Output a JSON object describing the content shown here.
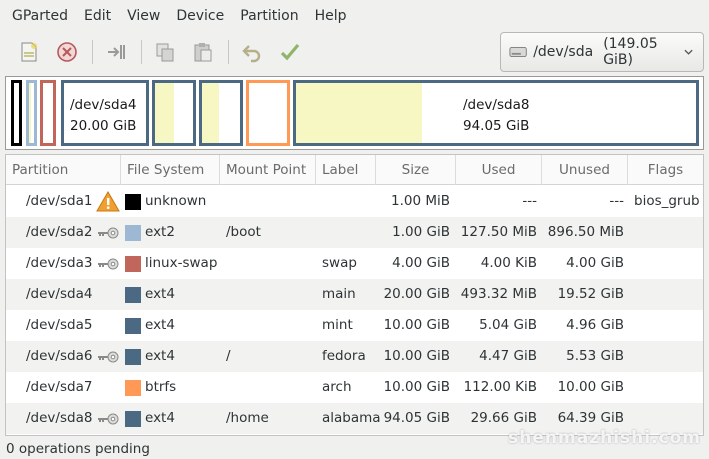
{
  "menu": [
    "GParted",
    "Edit",
    "View",
    "Device",
    "Partition",
    "Help"
  ],
  "toolbar": {
    "icons": [
      "new-partition-icon",
      "delete-partition-icon",
      "resize-move-icon",
      "copy-icon",
      "paste-icon",
      "undo-icon",
      "apply-icon"
    ]
  },
  "device": {
    "name": "/dev/sda",
    "size": "(149.05 GiB)"
  },
  "map": {
    "sda4": {
      "name": "/dev/sda4",
      "size": "20.00 GiB"
    },
    "sda8": {
      "name": "/dev/sda8",
      "size": "94.05 GiB"
    }
  },
  "columns": [
    "Partition",
    "File System",
    "Mount Point",
    "Label",
    "Size",
    "Used",
    "Unused",
    "Flags"
  ],
  "rows": [
    {
      "partition": "/dev/sda1",
      "icon": "warning",
      "fs": "unknown",
      "fs_color": "#000000",
      "mount": "",
      "label": "",
      "size": "1.00 MiB",
      "used": "---",
      "unused": "---",
      "flags": "bios_grub"
    },
    {
      "partition": "/dev/sda2",
      "icon": "key",
      "fs": "ext2",
      "fs_color": "#9db8d2",
      "mount": "/boot",
      "label": "",
      "size": "1.00 GiB",
      "used": "127.50 MiB",
      "unused": "896.50 MiB",
      "flags": ""
    },
    {
      "partition": "/dev/sda3",
      "icon": "key",
      "fs": "linux-swap",
      "fs_color": "#c1665a",
      "mount": "",
      "label": "swap",
      "size": "4.00 GiB",
      "used": "4.00 KiB",
      "unused": "4.00 GiB",
      "flags": ""
    },
    {
      "partition": "/dev/sda4",
      "icon": "",
      "fs": "ext4",
      "fs_color": "#4b6983",
      "mount": "",
      "label": "main",
      "size": "20.00 GiB",
      "used": "493.32 MiB",
      "unused": "19.52 GiB",
      "flags": ""
    },
    {
      "partition": "/dev/sda5",
      "icon": "",
      "fs": "ext4",
      "fs_color": "#4b6983",
      "mount": "",
      "label": "mint",
      "size": "10.00 GiB",
      "used": "5.04 GiB",
      "unused": "4.96 GiB",
      "flags": ""
    },
    {
      "partition": "/dev/sda6",
      "icon": "key",
      "fs": "ext4",
      "fs_color": "#4b6983",
      "mount": "/",
      "label": "fedora",
      "size": "10.00 GiB",
      "used": "4.47 GiB",
      "unused": "5.53 GiB",
      "flags": ""
    },
    {
      "partition": "/dev/sda7",
      "icon": "",
      "fs": "btrfs",
      "fs_color": "#ff9955",
      "mount": "",
      "label": "arch",
      "size": "10.00 GiB",
      "used": "112.00 KiB",
      "unused": "10.00 GiB",
      "flags": ""
    },
    {
      "partition": "/dev/sda8",
      "icon": "key",
      "fs": "ext4",
      "fs_color": "#4b6983",
      "mount": "/home",
      "label": "alabama",
      "size": "94.05 GiB",
      "used": "29.66 GiB",
      "unused": "64.39 GiB",
      "flags": ""
    }
  ],
  "status": "0 operations pending",
  "watermark": "shenmazhishi.com",
  "colors": {
    "ext4": "#4b6983",
    "ext2": "#9db8d2",
    "swap": "#c1665a",
    "btrfs": "#ff9955",
    "unknown": "#000000",
    "used_fill": "#f7f7c4"
  }
}
